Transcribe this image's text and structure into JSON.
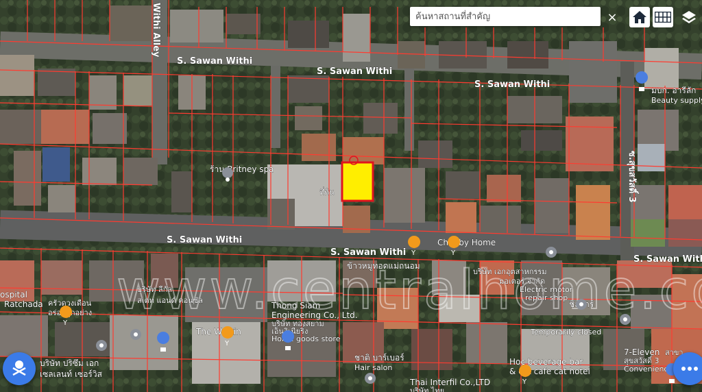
{
  "search": {
    "placeholder": "ค้นหาสถานที่สำคัญ",
    "value": ""
  },
  "toolbar": {
    "close": "×"
  },
  "icons": {
    "close": "close-icon",
    "home": "home-icon",
    "grid": "grid-icon",
    "layers": "layers-icon",
    "compass": "compass-icon",
    "fab_right": "fab-icon"
  },
  "colors": {
    "parcel_line": "#ff3b30",
    "highlight_fill": "#ffee00",
    "highlight_border": "#e0141e",
    "fab": "#3b7be8"
  },
  "watermark": "www.centralhome.co",
  "roads": {
    "r1": "Withi Alley",
    "r2": "S. Sawan Withi",
    "r3": "S. Sawan Withi",
    "r4": "S. Sawan Withi",
    "r5": "S. Sawan Withi",
    "r6": "S. Sawan Withi",
    "r7": "S. Sawan With",
    "r8": "ซ.สุขสวัสดิ์ 3"
  },
  "pois": {
    "britney": "ร้าน Britney spa",
    "chubby": "Chubby Home",
    "khao": "ข้าวหมูทอดแม่ถนอม",
    "company1": "บริษัท เอกอุตสาหกรรม",
    "company1b": "มอเตอร์ จำกัด",
    "electric": "Electric motor",
    "electric2": "repair shop",
    "hospital": "ospital",
    "ratchada": "Ratchada",
    "khrua": "ครัวดวงเดือน",
    "aroi": "อร่อยทุกอย่าง",
    "silik": "บริษัท ลีกัล",
    "silik2": "สเตท แอนด์ คอนซัล",
    "thongsiam": "Thong Siam",
    "thongsiam2": "Engineering Co., Ltd.",
    "thongsiam3": "บริษัท ทองสยาม",
    "thongsiam4": "เอ็นจิเนียริ่ง",
    "homegoods": "Home goods store",
    "welkin": "The Welkin",
    "silbar": "ชิลบาร์",
    "tempclosed": "Temporarily closed",
    "seven": "7-Eleven",
    "seven2": "สาขา",
    "seven3": "สุขสวัสดิ์ 3",
    "convenience": "Convenience s",
    "mbk": "มบก. อารีลัก",
    "beauty": "Beauty supply",
    "chat": "ชาติ บาร์เบอร์",
    "hair": "Hair salon",
    "thaiinterfil": "Thai Interfil Co.,LTD",
    "thaiinterfil2": "บริษัท ไทย",
    "hoc": "Hoc beverage bar",
    "hoc2": "& cat cafe cat hotel",
    "prisma": "บริษัท ปริซึม เอก",
    "prisma2": "เซลเลนท์ เซอร์วิส",
    "plot": "ที่ดิน"
  }
}
